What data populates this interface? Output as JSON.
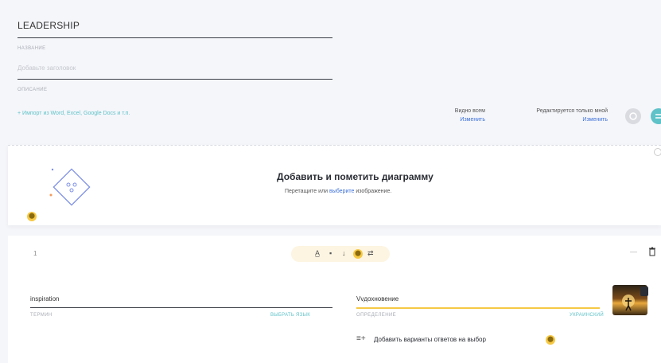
{
  "set": {
    "title_value": "LEADERSHIP",
    "title_label": "НАЗВАНИЕ",
    "title_placeholder": "Добавьте заголовок",
    "description_label": "ОПИСАНИЕ",
    "import_link": "+ Импорт из Word, Excel, Google Docs и т.п."
  },
  "visibility": {
    "visible_label": "Видно всем",
    "visible_change": "Изменить",
    "edit_label": "Редактируется только мной",
    "edit_change": "Изменить"
  },
  "diagram": {
    "title": "Добавить и пометить диаграмму",
    "subtitle_pre": "Перетащите или",
    "subtitle_link": "выберите",
    "subtitle_post": "изображение."
  },
  "card": {
    "number": "1",
    "term_value": "inspiration",
    "term_label": "ТЕРМИН",
    "term_lang": "ВЫБРАТЬ ЯЗЫК",
    "definition_value": "Vvдохновение",
    "definition_label": "ОПРЕДЕЛЕНИЕ",
    "definition_lang": "УКРАИНСКИЙ",
    "add_choices": "Добавить варианты ответов на выбор"
  },
  "colors": {
    "accent_teal": "#5ec2c8",
    "link_blue": "#3b6fd8",
    "highlight_yellow": "#f6c945"
  }
}
